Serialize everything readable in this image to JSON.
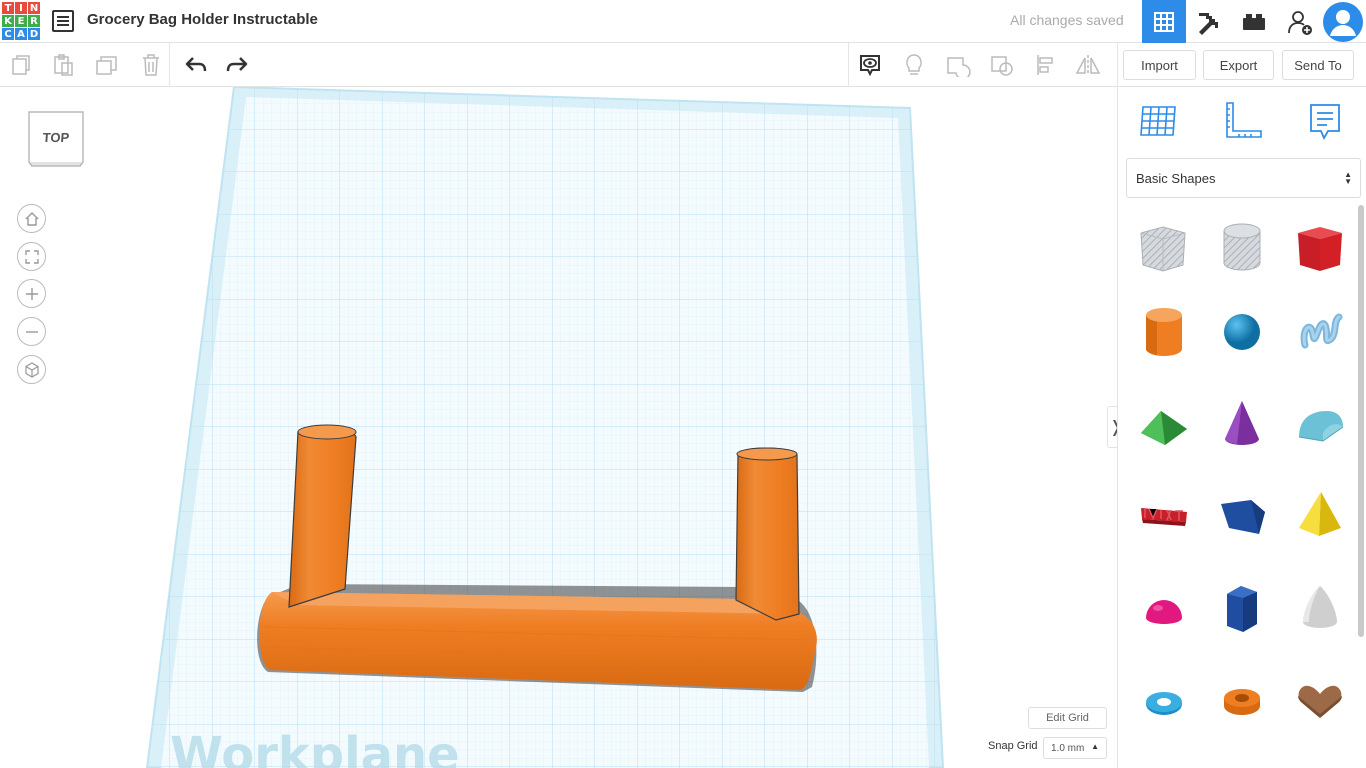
{
  "app": {
    "logo_letters": [
      "T",
      "I",
      "N",
      "K",
      "E",
      "R",
      "C",
      "A",
      "D"
    ],
    "logo_colors": [
      "#e84b3c",
      "#e84b3c",
      "#e84b3c",
      "#3dae49",
      "#3dae49",
      "#3dae49",
      "#2d8ce8",
      "#2d8ce8",
      "#2d8ce8"
    ],
    "design_title": "Grocery Bag Holder Instructable",
    "save_status": "All changes saved",
    "accent": "#2d8ce8"
  },
  "topbar_icons": [
    "3d-view-grid-icon",
    "minecraft-pickaxe-icon",
    "bricks-icon",
    "add-user-icon",
    "user-avatar-icon"
  ],
  "toolbar": {
    "left_tools": [
      "copy-icon",
      "paste-icon",
      "duplicate-icon",
      "delete-icon",
      "undo-icon",
      "redo-icon"
    ],
    "right_tools": [
      "notes-toggle-icon",
      "lightbulb-icon",
      "shape-group-icon",
      "shape-ungroup-icon",
      "align-icon",
      "mirror-icon"
    ],
    "import_label": "Import",
    "export_label": "Export",
    "sendto_label": "Send To"
  },
  "viewcube": {
    "label": "TOP"
  },
  "nav_controls": [
    "home-icon",
    "fit-view-icon",
    "zoom-in-icon",
    "zoom-out-icon",
    "perspective-icon"
  ],
  "workplane": {
    "label": "Workplane",
    "edit_grid_label": "Edit Grid",
    "snap_grid_label": "Snap Grid",
    "snap_grid_value": "1.0 mm",
    "grid_color": "#cfeaf5",
    "object_color": "#ef7d22"
  },
  "panel": {
    "view_icons": [
      "workplane-grid-icon",
      "ruler-icon",
      "notes-icon"
    ],
    "category": "Basic Shapes",
    "shapes": [
      {
        "name": "box-hole",
        "color": "#c7cbd1"
      },
      {
        "name": "cylinder-hole",
        "color": "#c7cbd1"
      },
      {
        "name": "box",
        "color": "#d32027"
      },
      {
        "name": "cylinder",
        "color": "#ef7d22"
      },
      {
        "name": "sphere",
        "color": "#1a8fc9"
      },
      {
        "name": "scribble",
        "color": "#8cc3e3"
      },
      {
        "name": "roof",
        "color": "#3aa144"
      },
      {
        "name": "cone",
        "color": "#7b2f9e"
      },
      {
        "name": "round-roof",
        "color": "#6cc1d6"
      },
      {
        "name": "text",
        "color": "#c8202a"
      },
      {
        "name": "wedge",
        "color": "#1f4ea0"
      },
      {
        "name": "pyramid",
        "color": "#f2d21b"
      },
      {
        "name": "half-sphere",
        "color": "#e0187f"
      },
      {
        "name": "polygon",
        "color": "#1f4ea0"
      },
      {
        "name": "paraboloid",
        "color": "#cfcfcf"
      },
      {
        "name": "torus",
        "color": "#1a8fc9"
      },
      {
        "name": "tube",
        "color": "#ef7d22"
      },
      {
        "name": "heart",
        "color": "#9c6a47"
      }
    ]
  }
}
